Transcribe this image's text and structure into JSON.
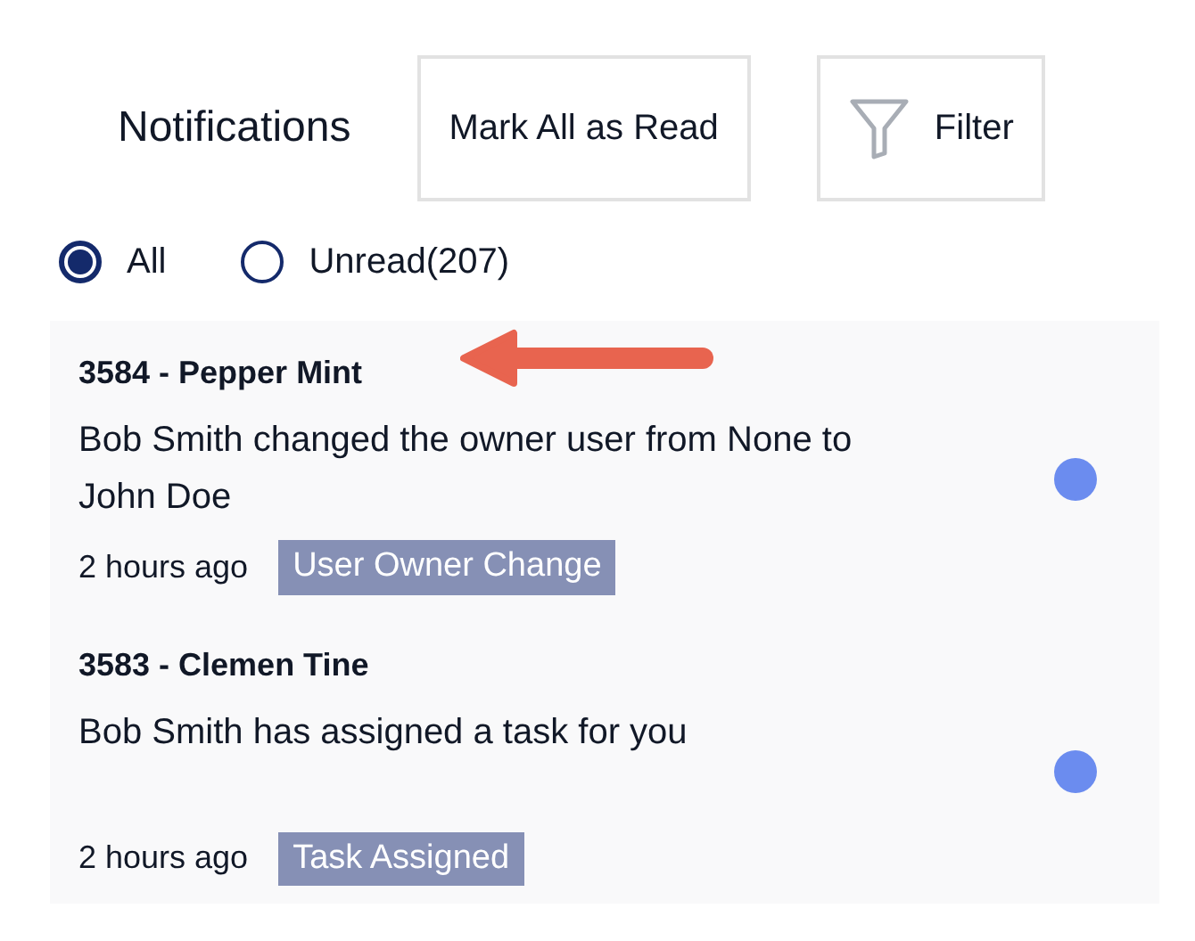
{
  "header": {
    "title": "Notifications",
    "buttons": [
      {
        "kind": "plain",
        "label": "Mark All as Read"
      },
      {
        "kind": "filter",
        "label": "Filter"
      }
    ]
  },
  "filter_options": [
    {
      "label": "All",
      "selected": true
    },
    {
      "label": "Unread(207)",
      "selected": false
    }
  ],
  "notifications": [
    {
      "title": "3584 - Pepper Mint",
      "message": "Bob Smith changed the owner user from None to John Doe",
      "time": "2 hours ago",
      "tag": "User Owner Change",
      "unread": true,
      "annotated": true
    },
    {
      "title": "3583 - Clemen Tine",
      "message": "Bob Smith has assigned a task for you",
      "time": "2 hours ago",
      "tag": "Task Assigned",
      "unread": true,
      "annotated": false
    }
  ]
}
